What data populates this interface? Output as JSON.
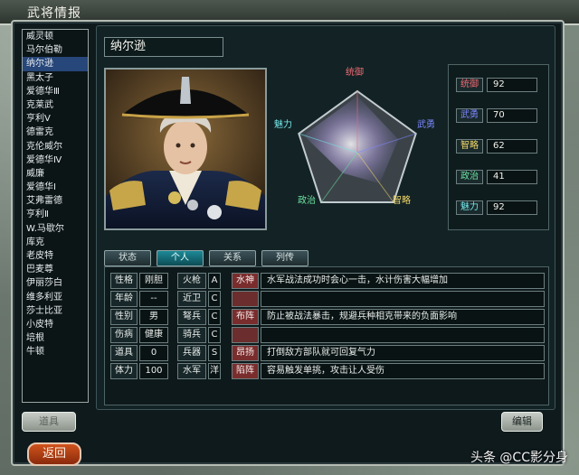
{
  "window": {
    "title": "武将情报"
  },
  "hero_list": [
    "威灵顿",
    "马尔伯勒",
    "纳尔逊",
    "黑太子",
    "爱德华Ⅲ",
    "克莱武",
    "亨利Ⅴ",
    "德雷克",
    "克伦威尔",
    "爱德华Ⅳ",
    "威廉",
    "爱德华Ⅰ",
    "艾弗雷德",
    "亨利Ⅱ",
    "W.马歇尔",
    "库克",
    "老皮特",
    "巴麦尊",
    "伊丽莎白",
    "维多利亚",
    "莎士比亚",
    "小皮特",
    "培根",
    "牛顿"
  ],
  "selected_hero": "纳尔逊",
  "hero": {
    "name": "纳尔逊"
  },
  "radar": {
    "labels": {
      "command": "统御",
      "valor": "武勇",
      "strategy": "智略",
      "politics": "政治",
      "charm": "魅力"
    },
    "label_colors": {
      "command": "#f06a73",
      "valor": "#7b86ff",
      "strategy": "#f3d86a",
      "politics": "#6be0a0",
      "charm": "#74e6ea"
    },
    "values": {
      "command": 92,
      "valor": 70,
      "strategy": 62,
      "politics": 41,
      "charm": 92
    }
  },
  "stats": [
    {
      "label": "统御",
      "value": "92",
      "color": "#f06a73"
    },
    {
      "label": "武勇",
      "value": "70",
      "color": "#7b86ff"
    },
    {
      "label": "智略",
      "value": "62",
      "color": "#f3d86a"
    },
    {
      "label": "政治",
      "value": "41",
      "color": "#6be0a0"
    },
    {
      "label": "魅力",
      "value": "92",
      "color": "#74e6ea"
    }
  ],
  "tabs": [
    {
      "label": "状态",
      "active": false
    },
    {
      "label": "个人",
      "active": true
    },
    {
      "label": "关系",
      "active": false
    },
    {
      "label": "列传",
      "active": false
    }
  ],
  "personal": [
    {
      "label": "性格",
      "value": "刚胆"
    },
    {
      "label": "年龄",
      "value": "--"
    },
    {
      "label": "性别",
      "value": "男"
    },
    {
      "label": "伤病",
      "value": "健康"
    },
    {
      "label": "道具",
      "value": "0"
    },
    {
      "label": "体力",
      "value": "100"
    }
  ],
  "aptitudes": [
    {
      "label": "火枪",
      "grade": "A"
    },
    {
      "label": "近卫",
      "grade": "C"
    },
    {
      "label": "弩兵",
      "grade": "C"
    },
    {
      "label": "骑兵",
      "grade": "C"
    },
    {
      "label": "兵器",
      "grade": "S"
    },
    {
      "label": "水军",
      "grade": "洋"
    }
  ],
  "skills": [
    {
      "name": "水神",
      "desc": "水军战法成功时会心一击，水计伤害大幅增加"
    },
    {
      "name": "",
      "desc": ""
    },
    {
      "name": "布阵",
      "desc": "防止被战法暴击，规避兵种相克带来的负面影响"
    },
    {
      "name": "",
      "desc": ""
    },
    {
      "name": "昂扬",
      "desc": "打倒敌方部队就可回复气力"
    },
    {
      "name": "陷阵",
      "desc": "容易触发单挑，攻击让人受伤"
    }
  ],
  "buttons": {
    "item": "道具",
    "edit": "编辑",
    "back": "返回"
  },
  "watermark": "头条 @CC影分身"
}
